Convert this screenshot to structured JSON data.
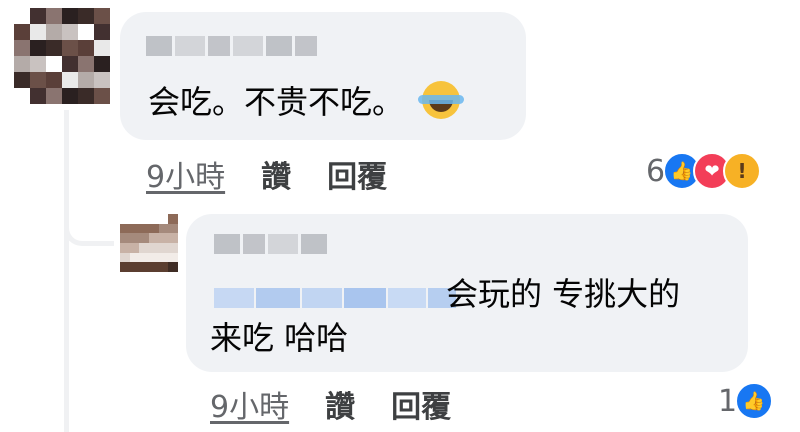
{
  "comment": {
    "text": "会吃。不贵不吃。",
    "emoji_icon": "laughing-tears-emoji",
    "time": "9小時",
    "like_label": "讚",
    "reply_label": "回覆",
    "reaction_count": "6",
    "reaction_icons": [
      "like-icon",
      "love-icon",
      "wow-icon"
    ]
  },
  "reply": {
    "text_line1": "会玩的 专挑大的",
    "text_line2": "来吃 哈哈",
    "time": "9小時",
    "like_label": "讚",
    "reply_label": "回覆",
    "reaction_count": "1",
    "reaction_icons": [
      "like-icon"
    ]
  },
  "colors": {
    "bubble": "#f0f2f5",
    "like_blue": "#1877f2",
    "love_red": "#f33e58",
    "wow_yellow": "#f7b125"
  }
}
